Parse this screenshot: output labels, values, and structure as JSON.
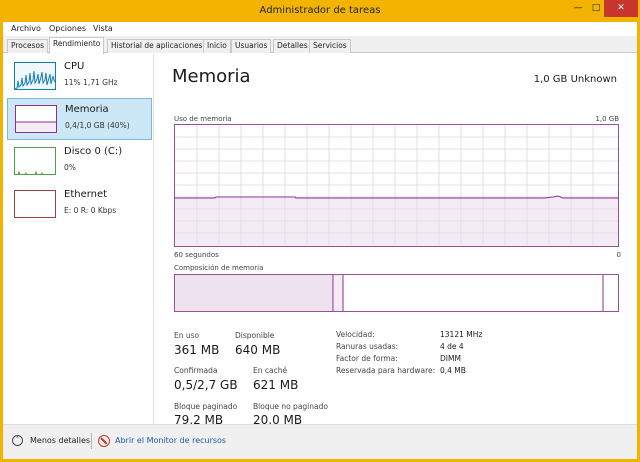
{
  "window": {
    "title": "Administrador de tareas",
    "controls": {
      "minimize": "—",
      "maximize": "□",
      "close": "✕"
    }
  },
  "menu": [
    "Archivo",
    "Opciones",
    "Vista"
  ],
  "tabs": [
    "Procesos",
    "Rendimiento",
    "Historial de aplicaciones",
    "Inicio",
    "Usuarios",
    "Detalles",
    "Servicios"
  ],
  "active_tab": "Rendimiento",
  "sidebar": {
    "items": [
      {
        "name": "CPU",
        "detail": "11%  1,71 GHz",
        "color": "#117dbb"
      },
      {
        "name": "Memoria",
        "detail": "0,4/1,0 GB (40%)",
        "color": "#8b2f8f",
        "selected": true
      },
      {
        "name": "Disco 0 (C:)",
        "detail": "0%",
        "color": "#4da04d"
      },
      {
        "name": "Ethernet",
        "detail": "E: 0  R: 0 Kbps",
        "color": "#a7413d"
      }
    ]
  },
  "main": {
    "title": "Memoria",
    "total": "1,0 GB Unknown",
    "graph": {
      "label": "Uso de memoria",
      "max_label": "1,0 GB",
      "time_label": "60 segundos",
      "end_label": "0",
      "usage_fraction": 0.4
    },
    "composition": {
      "label": "Composición de memoria",
      "in_use_fraction": 0.361,
      "modified_fraction": 0.03,
      "free_fraction": 0.03
    },
    "stats": {
      "in_use": {
        "label": "En uso",
        "value": "361 MB"
      },
      "available": {
        "label": "Disponible",
        "value": "640 MB"
      },
      "committed": {
        "label": "Confirmada",
        "value": "0,5/2,7 GB"
      },
      "cached": {
        "label": "En caché",
        "value": "621 MB"
      },
      "paged_pool": {
        "label": "Bloque paginado",
        "value": "79,2 MB"
      },
      "nonpaged_pool": {
        "label": "Bloque no paginado",
        "value": "20,0 MB"
      }
    },
    "properties": [
      {
        "key": "Velocidad:",
        "value": "13121 MHz"
      },
      {
        "key": "Ranuras usadas:",
        "value": "4 de 4"
      },
      {
        "key": "Factor de forma:",
        "value": "DIMM"
      },
      {
        "key": "Reservada para hardware:",
        "value": "0,4 MB"
      }
    ]
  },
  "footer": {
    "less_details": "Menos detalles",
    "resource_monitor": "Abrir el Monitor de recursos"
  }
}
